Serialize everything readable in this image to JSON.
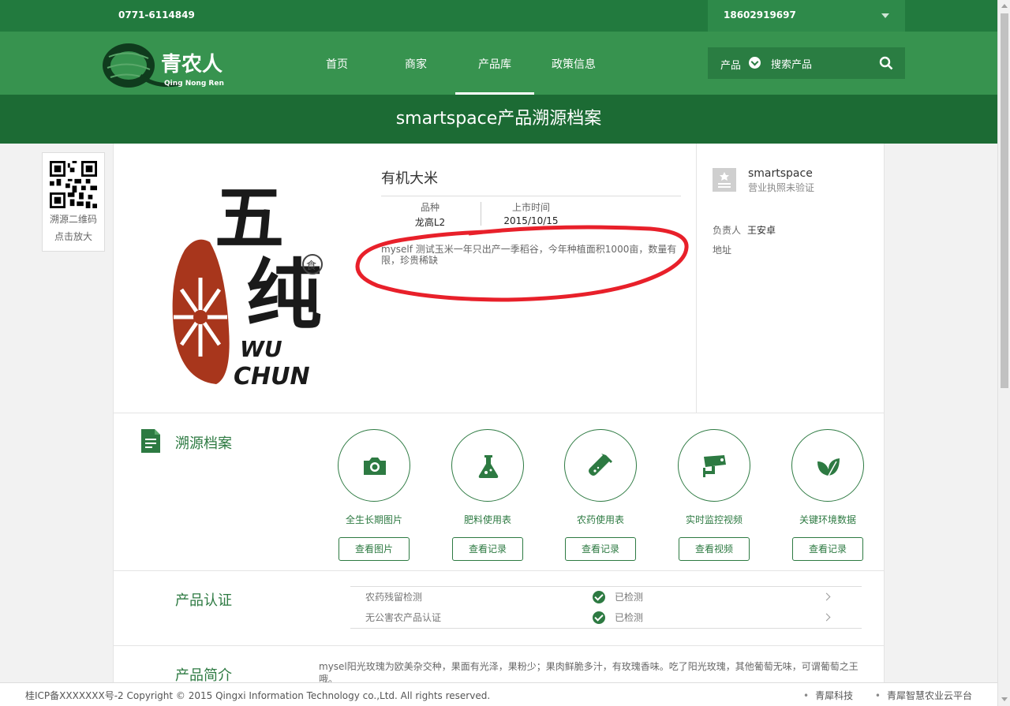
{
  "topbar": {
    "phone": "0771-6114849",
    "account": "18602919697"
  },
  "logo": {
    "brand": "青农人",
    "pinyin": "Qing Nong Ren"
  },
  "nav": [
    {
      "label": "首页"
    },
    {
      "label": "商家"
    },
    {
      "label": "产品库"
    },
    {
      "label": "政策信息"
    }
  ],
  "search": {
    "category": "产品",
    "placeholder": "搜索产品"
  },
  "banner": {
    "title": "smartspace产品溯源档案"
  },
  "qr": {
    "line1": "溯源二维码",
    "line2": "点击放大"
  },
  "product": {
    "name": "有机大米",
    "variety_label": "品种",
    "variety": "龙高L2",
    "date_label": "上市时间",
    "date": "2015/10/15",
    "description": "myself 测试玉米一年只出产一季稻谷，今年种植面积1000亩，数量有限，珍贵稀缺",
    "image_text": {
      "hanzi1": "五",
      "hanzi2": "纯",
      "seal": "食",
      "en1": "WU",
      "en2": "CHUN"
    }
  },
  "seller": {
    "name": "smartspace",
    "license": "营业执照未验证",
    "owner_label": "负责人",
    "owner": "王安卓",
    "address_label": "地址"
  },
  "trace": {
    "title": "溯源档案",
    "items": [
      {
        "label": "全生长期图片",
        "button": "查看图片",
        "icon": "camera-icon"
      },
      {
        "label": "肥料使用表",
        "button": "查看记录",
        "icon": "flask-icon"
      },
      {
        "label": "农药使用表",
        "button": "查看记录",
        "icon": "test-tube-icon"
      },
      {
        "label": "实时监控视频",
        "button": "查看视频",
        "icon": "cctv-camera-icon"
      },
      {
        "label": "关键环境数据",
        "button": "查看记录",
        "icon": "leaf-icon"
      }
    ]
  },
  "certification": {
    "title": "产品认证",
    "rows": [
      {
        "name": "农药残留检测",
        "status": "已检测"
      },
      {
        "name": "无公害农产品认证",
        "status": "已检测"
      }
    ]
  },
  "intro": {
    "title": "产品简介",
    "text": "mysel阳光玫瑰为欧美杂交种，果面有光泽，果粉少；果肉鲜脆多汁，有玫瑰香味。吃了阳光玫瑰，其他葡萄无味，可谓葡萄之王哦。"
  },
  "footer": {
    "copyright": "桂ICP备XXXXXXX号-2 Copyright © 2015 Qingxi Information Technology co.,Ltd. All rights reserved.",
    "link1": "青犀科技",
    "link2": "青犀智慧农业云平台"
  },
  "colors": {
    "primary": "#37934f",
    "dark": "#1c6b34",
    "accent": "#2d7a42",
    "annotation": "#e8202a"
  }
}
